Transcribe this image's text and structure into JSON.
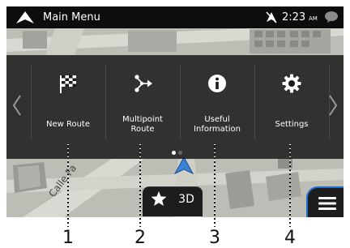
{
  "status_bar": {
    "title": "Main Menu",
    "time": "2:23",
    "ampm": "AM",
    "icons": {
      "nav": "navigation-arrow-icon",
      "gps": "gps-off-icon",
      "message": "message-bubble-icon"
    }
  },
  "menu": {
    "items": [
      {
        "label_line1": "New Route",
        "label_line2": "",
        "icon": "checkered-flag-icon"
      },
      {
        "label_line1": "Multipoint",
        "label_line2": "Route",
        "icon": "multipoint-route-icon"
      },
      {
        "label_line1": "Useful",
        "label_line2": "Information",
        "icon": "info-icon"
      },
      {
        "label_line1": "Settings",
        "label_line2": "",
        "icon": "gear-icon"
      }
    ],
    "pages": 2,
    "current_page": 1,
    "arrows": {
      "left": "chevron-left-icon",
      "right": "chevron-right-icon"
    }
  },
  "map": {
    "street_label": "Calle Fa"
  },
  "bottom": {
    "view_mode": "3D",
    "favorite_icon": "star-icon",
    "menu_icon": "hamburger-menu-icon"
  },
  "callouts": [
    "1",
    "2",
    "3",
    "4"
  ],
  "colors": {
    "status_bar": "#0d0d0d",
    "panel": "#1a1a1a",
    "accent": "#1f6fd1",
    "map_road": "#d7d7d0",
    "map_building": "#8f8f8a"
  }
}
